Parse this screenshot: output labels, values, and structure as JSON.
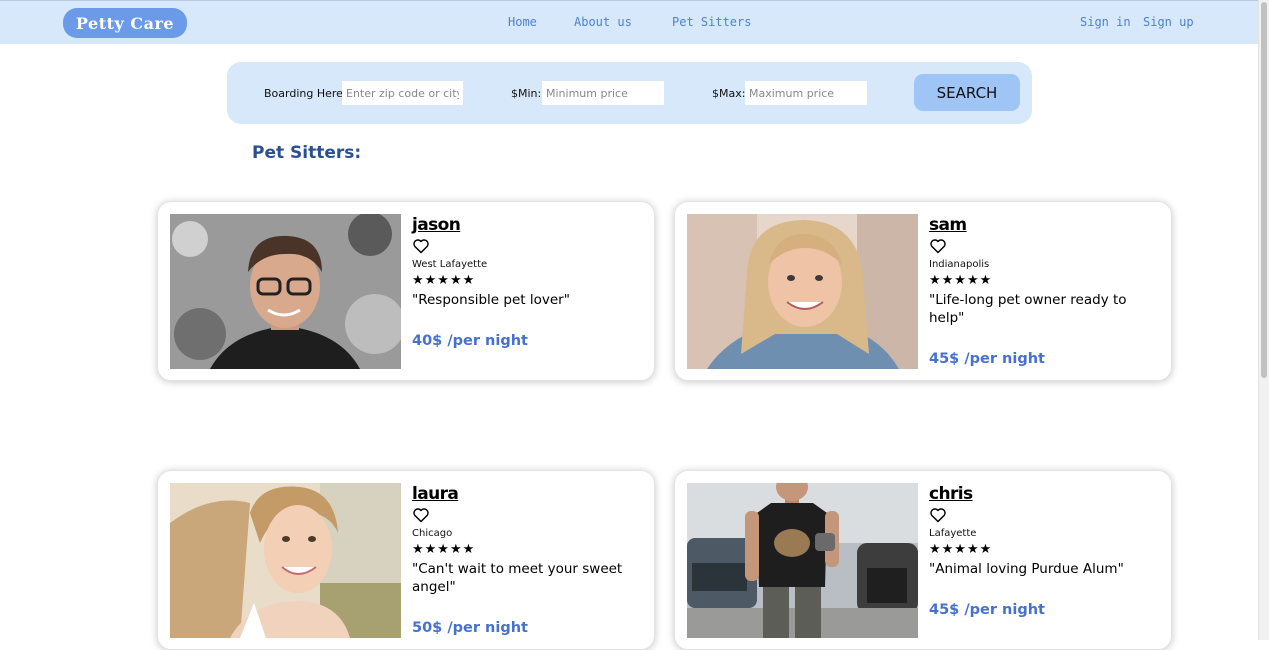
{
  "header": {
    "logo_text": "Petty Care",
    "nav": {
      "home": "Home",
      "about": "About us",
      "pet_sitters": "Pet Sitters"
    },
    "auth": {
      "sign_in": "Sign in",
      "sign_up": "Sign up"
    }
  },
  "search": {
    "boarding_label": "Boarding Here:",
    "boarding_placeholder": "Enter zip code or city",
    "min_label": "$Min:",
    "min_placeholder": "Minimum price",
    "max_label": "$Max:",
    "max_placeholder": "Maximum price",
    "button_label": "SEARCH"
  },
  "section_title": "Pet Sitters:",
  "sitters": [
    {
      "name": "jason",
      "city": "West Lafayette",
      "rating": "★★★★★",
      "quote": "\"Responsible pet lover\"",
      "price": "40$ /per night"
    },
    {
      "name": "sam",
      "city": "Indianapolis",
      "rating": "★★★★★",
      "quote": "\"Life-long pet owner ready to help\"",
      "price": "45$ /per night"
    },
    {
      "name": "laura",
      "city": "Chicago",
      "rating": "★★★★★",
      "quote": "\"Can't wait to meet your sweet angel\"",
      "price": "50$ /per night"
    },
    {
      "name": "chris",
      "city": "Lafayette",
      "rating": "★★★★★",
      "quote": "\"Animal loving Purdue Alum\"",
      "price": "45$ /per night"
    }
  ],
  "colors": {
    "header_bg": "#d6e8fa",
    "link": "#4f82cf",
    "logo_bg": "#6b9be8",
    "search_button": "#9fc5f7",
    "heading": "#2b4f91",
    "price": "#4671cf"
  },
  "icons": {
    "favorite": "heart-outline-icon",
    "rating": "star-icon"
  }
}
